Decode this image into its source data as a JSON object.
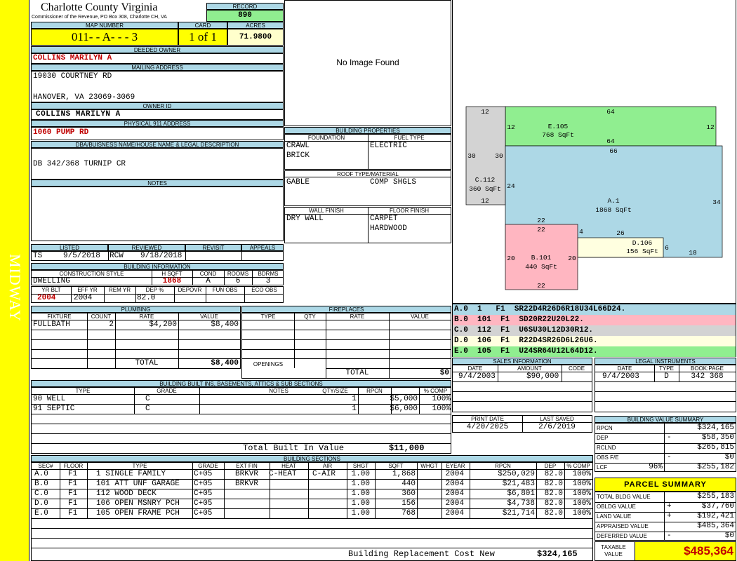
{
  "sidebar": {
    "label": "MIDWAY"
  },
  "header": {
    "county": "Charlotte County Virginia",
    "commissioner": "Commissioner of the Revenue, PO Box 308, Charlotte CH, VA",
    "record_label": "RECORD",
    "record": "890"
  },
  "parcel": {
    "map_label": "MAP NUMBER",
    "map_number": "011- - A- - - 3",
    "card_label": "CARD",
    "card": "1 of 1",
    "acres_label": "ACRES",
    "acres": "71.9800"
  },
  "owner": {
    "deeded_label": "DEEDED OWNER",
    "deeded": "COLLINS MARILYN A",
    "mailing_label": "MAILING ADDRESS",
    "mail1": "19030 COURTNEY RD",
    "mail2": "HANOVER, VA 23069-3069",
    "owner_id_label": "OWNER ID",
    "owner_id": "COLLINS MARILYN A",
    "phys_label": "PHYSICAL 911 ADDRESS",
    "phys": "1060 PUMP RD"
  },
  "legal": {
    "label": "DBA/BUISNESS NAME/HOUSE NAME & LEGAL DESCRIPTION",
    "text": "DB 342/368 TURNIP CR"
  },
  "notes": {
    "label": "NOTES"
  },
  "listing": {
    "listed_label": "LISTED",
    "reviewed_label": "REVIEWED",
    "revisit_label": "REVISIT",
    "appeals_label": "APPEALS",
    "listed_by": "TS",
    "listed_date": "9/5/2018",
    "reviewed_by": "RCW",
    "reviewed_date": "9/18/2018"
  },
  "building_info": {
    "label": "BUILDING INFORMATION",
    "style_label": "CONSTRUCTION STYLE",
    "hsqft_label": "H SQFT",
    "cond_label": "COND",
    "rooms_label": "ROOMS",
    "bdrms_label": "BDRMS",
    "style": "DWELLING",
    "hsqft": "1868",
    "cond": "A",
    "rooms": "6",
    "bdrms": "3",
    "yrblt_label": "YR BLT",
    "effyr_label": "EFF YR",
    "remyr_label": "REM YR",
    "dep_label": "DEP %",
    "depovr_label": "DEPOVR",
    "funobs_label": "FUN OBS",
    "ecoobs_label": "ECO OBS",
    "yrblt": "2004",
    "effyr": "2004",
    "dep": "82.0"
  },
  "image": {
    "text": "No Image Found"
  },
  "building_props": {
    "label": "BUILDING PROPERTIES",
    "foundation_label": "FOUNDATION",
    "fuel_label": "FUEL TYPE",
    "foundation1": "CRAWL",
    "foundation2": "BRICK",
    "fuel": "ELECTRIC",
    "roof_label": "ROOF TYPE/MATERIAL",
    "roof_type": "GABLE",
    "roof_mat": "COMP SHGLS",
    "wall_label": "WALL FINISH",
    "floor_label": "FLOOR FINISH",
    "wall": "DRY WALL",
    "floor1": "CARPET",
    "floor2": "HARDWOOD"
  },
  "sketch": {
    "areas": [
      {
        "id": "E.105",
        "sqft": "768 SqFt",
        "color": "#90ee90"
      },
      {
        "id": "C.112",
        "sqft": "360 SqFt",
        "color": "#d3d3d3"
      },
      {
        "id": "A.1",
        "sqft": "1868 SqFt",
        "color": "#add8e6"
      },
      {
        "id": "D.106",
        "sqft": "156 SqFt",
        "color": "#ffffe0"
      },
      {
        "id": "B.101",
        "sqft": "440 SqFt",
        "color": "#ffb6c1"
      }
    ],
    "dims": [
      "12",
      "64",
      "12",
      "12",
      "64",
      "66",
      "30",
      "30",
      "24",
      "12",
      "34",
      "22",
      "22",
      "4",
      "26",
      "6",
      "18",
      "20",
      "20",
      "22"
    ]
  },
  "vectors": [
    {
      "text": "A.0  1   F1  SR22D4R26D6R18U34L66D24.",
      "color": "#add8e6"
    },
    {
      "text": "B.0  101  F1  SD20R22U20L22.",
      "color": "#ffb6c1"
    },
    {
      "text": "C.0  112  F1  U6SU30L12D30R12.",
      "color": "#d3d3d3"
    },
    {
      "text": "D.0  106  F1  R22D4SR26D6L26U6.",
      "color": "#ffffe0"
    },
    {
      "text": "E.0  105  F1  U24SR64U12L64D12.",
      "color": "#90ee90"
    }
  ],
  "plumbing": {
    "label": "PLUMBING",
    "cols": [
      "FIXTURE",
      "COUNT",
      "RATE",
      "VALUE"
    ],
    "fixture": "FULLBATH",
    "count": "2",
    "rate": "$4,200",
    "value": "$8,400",
    "total_label": "TOTAL",
    "total": "$8,400"
  },
  "fireplaces": {
    "label": "FIREPLACES",
    "cols": [
      "TYPE",
      "QTY",
      "RATE",
      "VALUE"
    ],
    "openings_label": "OPENINGS",
    "total_label": "TOTAL",
    "total": "$0"
  },
  "sales": {
    "label": "SALES INFORMATION",
    "cols": [
      "DATE",
      "AMOUNT",
      "CODE"
    ],
    "date": "9/4/2003",
    "amount": "$90,000"
  },
  "legal_inst": {
    "label": "LEGAL INSTRUMENTS",
    "cols": [
      "DATE",
      "TYPE",
      "BOOK:PAGE"
    ],
    "date": "9/4/2003",
    "type": "D",
    "book": "342 368"
  },
  "print": {
    "print_label": "PRINT DATE",
    "saved_label": "LAST SAVED",
    "print_date": "4/20/2025",
    "saved": "2/6/2019"
  },
  "builtins": {
    "label": "BUILDING BUILT INS, BASEMENTS, ATTICS & SUB SECTIONS",
    "cols": [
      "TYPE",
      "GRADE",
      "NOTES",
      "QTY/SIZE",
      "RPCN",
      "% COMP"
    ],
    "rows": [
      {
        "type": "90 WELL",
        "grade": "C",
        "qty": "1",
        "rpcn": "$5,000",
        "comp": "100%"
      },
      {
        "type": "91 SEPTIC",
        "grade": "C",
        "qty": "1",
        "rpcn": "$6,000",
        "comp": "100%"
      }
    ],
    "total_label": "Total Built In Value",
    "total": "$11,000"
  },
  "value_summary": {
    "label": "BUILDING VALUE SUMMARY",
    "rpcn_label": "RPCN",
    "rpcn": "$324,165",
    "dep_label": "DEP",
    "dep_sign": "-",
    "dep": "$58,350",
    "rclnd_label": "RCLND",
    "rclnd": "$265,815",
    "obs_label": "OBS F/E",
    "obs_sign": "-",
    "obs": "$0",
    "lcf_label": "LCF",
    "lcf_pct": "96%",
    "lcf": "$255,182"
  },
  "parcel_summary": {
    "label": "PARCEL SUMMARY",
    "tbv_label": "TOTAL BLDG VALUE",
    "tbv": "$255,183",
    "obldg_label": "OBLDG VALUE",
    "obldg_sign": "+",
    "obldg": "$37,760",
    "land_label": "LAND VALUE",
    "land_sign": "+",
    "land": "$192,421",
    "appr_label": "APPRAISED VALUE",
    "appr": "$485,364",
    "def_label": "DEFERRED VALUE",
    "def_sign": "-",
    "def": "$0",
    "taxable_label1": "TAXABLE",
    "taxable_label2": "VALUE",
    "taxable": "$485,364"
  },
  "sections": {
    "label": "BUILDING SECTIONS",
    "cols": [
      "SEC#",
      "FLOOR",
      "TYPE",
      "GRADE",
      "EXT FIN",
      "HEAT",
      "AIR",
      "SHGT",
      "SQFT",
      "WHGT",
      "EYEAR",
      "RPCN",
      "DEP",
      "% COMP"
    ],
    "rows": [
      {
        "sec": "A.0",
        "floor": "F1",
        "type": "1 SINGLE FAMILY",
        "grade": "C+05",
        "ext": "BRKVR",
        "heat": "C-HEAT",
        "air": "C-AIR",
        "shgt": "1.00",
        "sqft": "1,868",
        "eyear": "2004",
        "rpcn": "$250,029",
        "dep": "82.0",
        "comp": "100%"
      },
      {
        "sec": "B.0",
        "floor": "F1",
        "type": "101 ATT UNF GARAGE",
        "grade": "C+05",
        "ext": "BRKVR",
        "heat": "",
        "air": "",
        "shgt": "1.00",
        "sqft": "440",
        "eyear": "2004",
        "rpcn": "$21,483",
        "dep": "82.0",
        "comp": "100%"
      },
      {
        "sec": "C.0",
        "floor": "F1",
        "type": "112 WOOD DECK",
        "grade": "C+05",
        "ext": "",
        "heat": "",
        "air": "",
        "shgt": "1.00",
        "sqft": "360",
        "eyear": "2004",
        "rpcn": "$6,801",
        "dep": "82.0",
        "comp": "100%"
      },
      {
        "sec": "D.0",
        "floor": "F1",
        "type": "106 OPEN MSNRY PCH",
        "grade": "C+05",
        "ext": "",
        "heat": "",
        "air": "",
        "shgt": "1.00",
        "sqft": "156",
        "eyear": "2004",
        "rpcn": "$4,738",
        "dep": "82.0",
        "comp": "100%"
      },
      {
        "sec": "E.0",
        "floor": "F1",
        "type": "105 OPEN FRAME PCH",
        "grade": "C+05",
        "ext": "",
        "heat": "",
        "air": "",
        "shgt": "1.00",
        "sqft": "768",
        "eyear": "2004",
        "rpcn": "$21,714",
        "dep": "82.0",
        "comp": "100%"
      }
    ],
    "total_label": "Building Replacement Cost New",
    "total": "$324,165"
  },
  "colors": {
    "yellow": "#ffff00",
    "header_blue": "#add8e6",
    "record_green": "#90ee90",
    "value_red": "#c00000",
    "light_yellow": "#ffffcc"
  }
}
